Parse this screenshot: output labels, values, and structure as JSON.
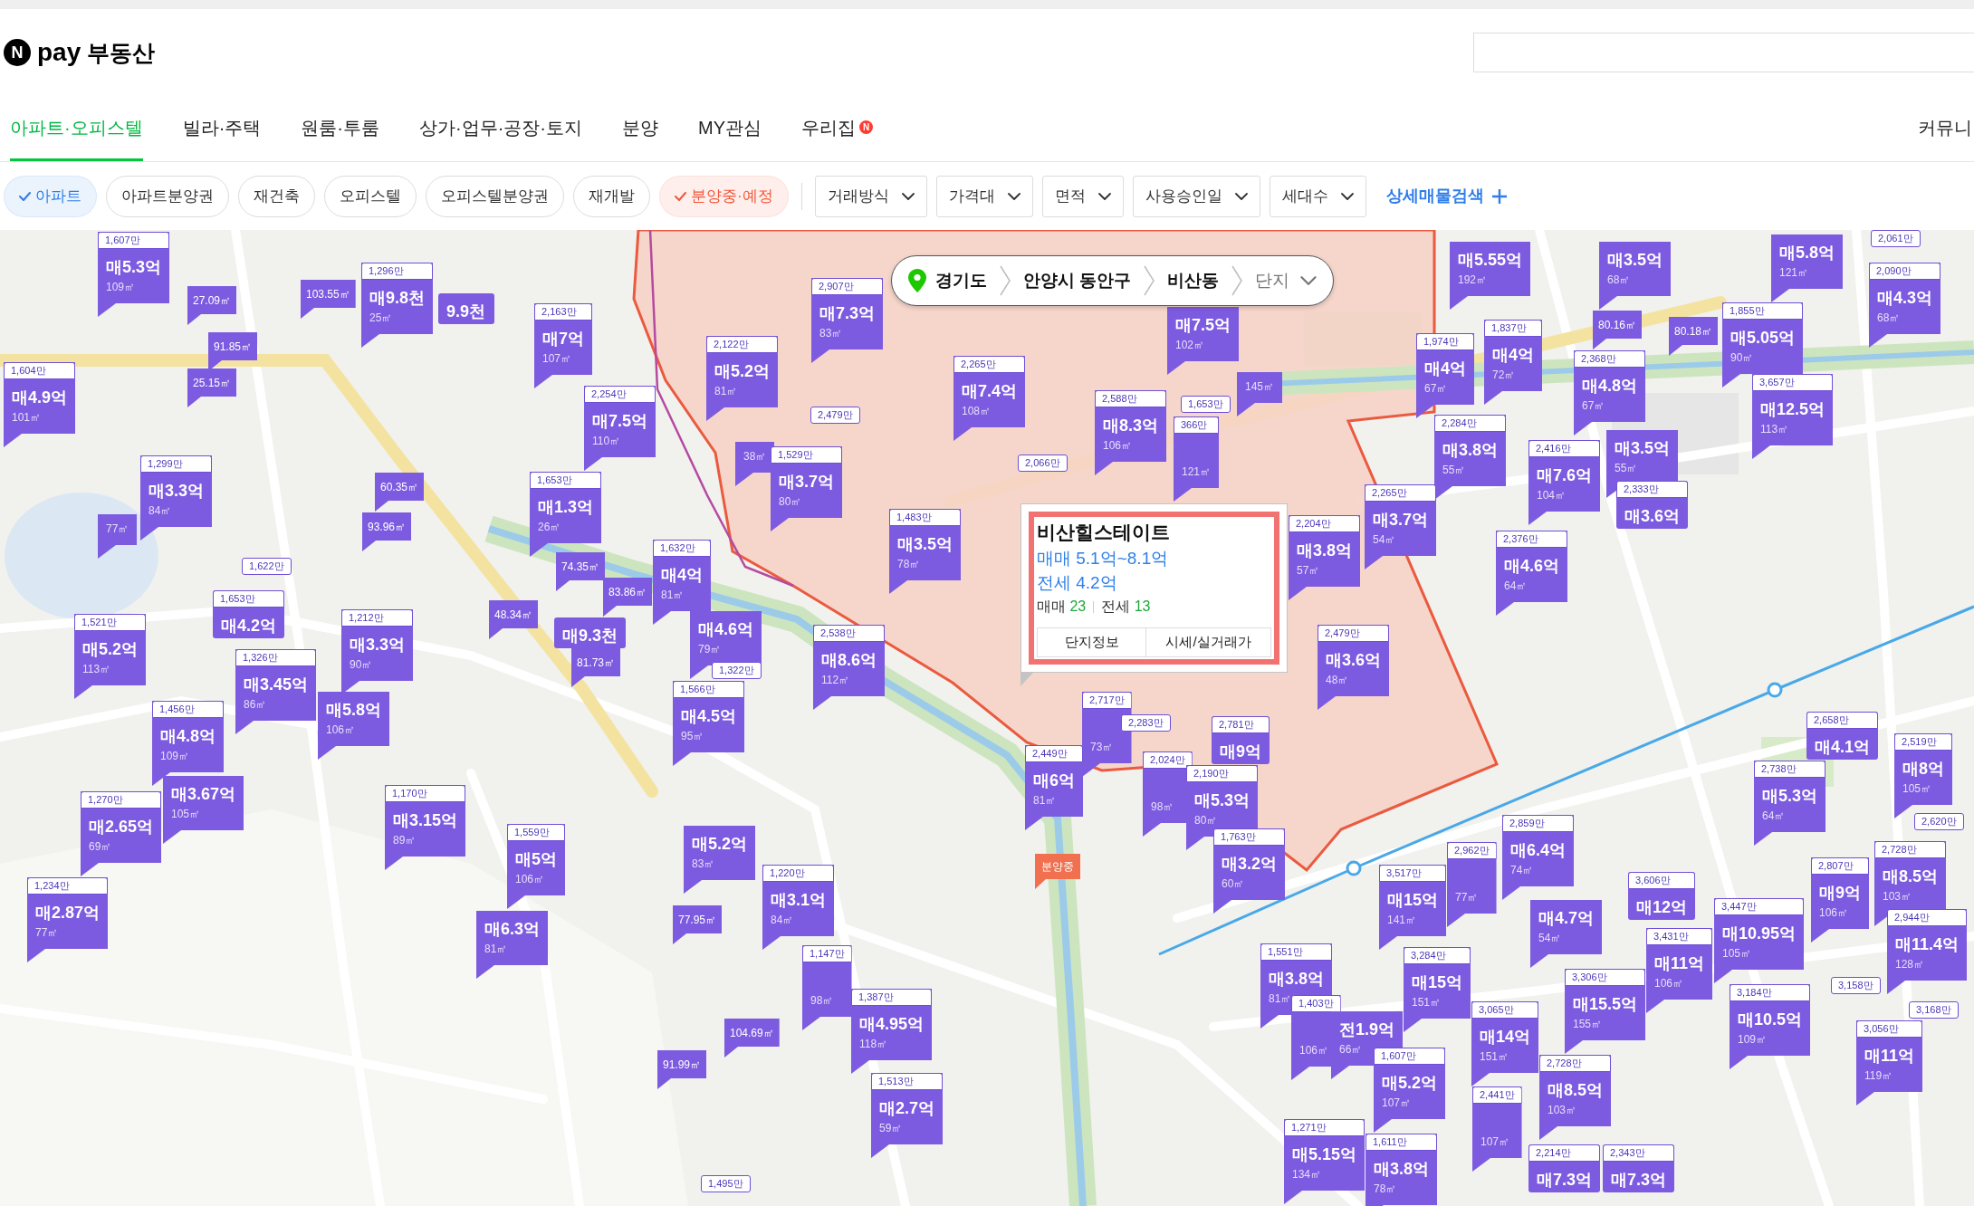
{
  "header": {
    "logo": {
      "badge": "N",
      "brand": "pay",
      "title": "부동산"
    }
  },
  "nav_tabs": [
    {
      "label": "아파트·오피스텔",
      "selected": true
    },
    {
      "label": "빌라·주택",
      "selected": false
    },
    {
      "label": "원룸·투룸",
      "selected": false
    },
    {
      "label": "상가·업무·공장·토지",
      "selected": false
    },
    {
      "label": "분양",
      "selected": false
    },
    {
      "label": "MY관심",
      "selected": false
    },
    {
      "label": "우리집",
      "selected": false,
      "badge": "N"
    },
    {
      "label": "커뮤니",
      "selected": false
    }
  ],
  "type_chips": [
    {
      "label": "아파트",
      "selected": true,
      "color": "#2e7de9"
    },
    {
      "label": "아파트분양권",
      "selected": false
    },
    {
      "label": "재건축",
      "selected": false
    },
    {
      "label": "오피스텔",
      "selected": false
    },
    {
      "label": "오피스텔분양권",
      "selected": false
    },
    {
      "label": "재개발",
      "selected": false
    },
    {
      "label": "분양중·예정",
      "selected": true,
      "color": "#f1573a"
    }
  ],
  "filters": [
    {
      "label": "거래방식"
    },
    {
      "label": "가격대"
    },
    {
      "label": "면적"
    },
    {
      "label": "사용승인일"
    },
    {
      "label": "세대수"
    }
  ],
  "detail_search": {
    "label": "상세매물검색"
  },
  "map": {
    "breadcrumb": {
      "levels": [
        "경기도",
        "안양시 동안구",
        "비산동"
      ],
      "dropdown": "단지"
    },
    "markers": [
      {
        "kind": "listing",
        "unit_price": "1,607만",
        "price": "매5.3억",
        "area": "109㎡"
      },
      {
        "kind": "listing",
        "price": "매5.55억",
        "area": "192㎡"
      },
      {
        "kind": "listing",
        "price": "매3.5억",
        "area": "68㎡"
      },
      {
        "kind": "listing",
        "price": "매5.8억",
        "area": "121㎡"
      },
      {
        "kind": "listing",
        "unit_price": "2,061만"
      },
      {
        "kind": "area",
        "area": "27.09㎡"
      },
      {
        "kind": "area",
        "area": "103.55㎡"
      },
      {
        "kind": "listing",
        "unit_price": "1,296만",
        "price": "매9.8천",
        "area": "25㎡"
      },
      {
        "kind": "listing",
        "price": "9.9천"
      },
      {
        "kind": "listing",
        "unit_price": "2,907만",
        "price": "매7.3억",
        "area": "83㎡"
      },
      {
        "kind": "listing",
        "unit_price": "2,090만",
        "price": "매4.3억",
        "area": "68㎡"
      },
      {
        "kind": "area",
        "area": "91.85㎡"
      },
      {
        "kind": "listing",
        "unit_price": "2,163만",
        "price": "매7억",
        "area": "107㎡"
      },
      {
        "kind": "listing",
        "price": "매7.5억",
        "area": "102㎡"
      },
      {
        "kind": "area",
        "area": "80.16㎡"
      },
      {
        "kind": "area",
        "area": "80.18㎡"
      },
      {
        "kind": "listing",
        "unit_price": "1,855만",
        "price": "매5.05억",
        "area": "90㎡"
      },
      {
        "kind": "area",
        "area": "25.15㎡"
      },
      {
        "kind": "listing",
        "unit_price": "2,122만",
        "price": "매5.2억",
        "area": "81㎡"
      },
      {
        "kind": "listing",
        "unit_price": "1,974만",
        "price": "매4억",
        "area": "67㎡"
      },
      {
        "kind": "listing",
        "unit_price": "1,837만",
        "price": "매4억",
        "area": "72㎡"
      },
      {
        "kind": "listing",
        "unit_price": "1,604만",
        "price": "매4.9억",
        "area": "101㎡"
      },
      {
        "kind": "listing",
        "unit_price": "2,254만",
        "price": "매7.5억",
        "area": "110㎡"
      },
      {
        "kind": "listing",
        "unit_price": "2,479만"
      },
      {
        "kind": "listing",
        "unit_price": "2,265만",
        "price": "매7.4억",
        "area": "108㎡"
      },
      {
        "kind": "listing",
        "unit_price": "2,588만",
        "price": "매8.3억",
        "area": "106㎡"
      },
      {
        "kind": "listing",
        "unit_price": "1,653만"
      },
      {
        "kind": "listing",
        "unit_price": "366만",
        "area": "121㎡"
      },
      {
        "kind": "listing",
        "area": "145㎡"
      },
      {
        "kind": "listing",
        "unit_price": "2,284만",
        "price": "매3.8억",
        "area": "55㎡"
      },
      {
        "kind": "listing",
        "unit_price": "2,368만",
        "price": "매4.8억",
        "area": "67㎡"
      },
      {
        "kind": "listing",
        "unit_price": "3,657만",
        "price": "매12.5억",
        "area": "113㎡"
      },
      {
        "kind": "listing",
        "area": "38㎡"
      },
      {
        "kind": "listing",
        "unit_price": "1,529만",
        "price": "매3.7억",
        "area": "80㎡"
      },
      {
        "kind": "listing",
        "unit_price": "2,066만"
      },
      {
        "kind": "listing",
        "unit_price": "2,416만",
        "price": "매7.6억",
        "area": "104㎡"
      },
      {
        "kind": "listing",
        "price": "매3.5억",
        "area": "55㎡"
      },
      {
        "kind": "listing",
        "area": "77㎡"
      },
      {
        "kind": "listing",
        "unit_price": "1,299만",
        "price": "매3.3억",
        "area": "84㎡"
      },
      {
        "kind": "area",
        "area": "60.35㎡"
      },
      {
        "kind": "area",
        "area": "93.96㎡"
      },
      {
        "kind": "listing",
        "unit_price": "1,653만",
        "price": "매1.3억",
        "area": "26㎡"
      },
      {
        "kind": "listing",
        "unit_price": "2,333만",
        "price": "매3.6억"
      },
      {
        "kind": "listing",
        "unit_price": "1,483만",
        "price": "매3.5억",
        "area": "78㎡"
      },
      {
        "kind": "listing",
        "unit_price": "2,265만",
        "price": "매3.7억",
        "area": "54㎡"
      },
      {
        "kind": "listing",
        "unit_price": "1,622만"
      },
      {
        "kind": "area",
        "area": "74.35㎡"
      },
      {
        "kind": "listing",
        "unit_price": "1,632만",
        "price": "매4억",
        "area": "81㎡"
      },
      {
        "kind": "listing",
        "unit_price": "2,204만",
        "price": "매3.8억",
        "area": "57㎡"
      },
      {
        "kind": "listing",
        "unit_price": "2,376만",
        "price": "매4.6억",
        "area": "64㎡"
      },
      {
        "kind": "listing",
        "unit_price": "1,653만",
        "price": "매4.2억"
      },
      {
        "kind": "area",
        "area": "48.34㎡"
      },
      {
        "kind": "area",
        "area": "83.86㎡"
      },
      {
        "kind": "listing",
        "unit_price": "1,521만",
        "price": "매5.2억",
        "area": "113㎡"
      },
      {
        "kind": "listing",
        "unit_price": "1,212만",
        "price": "매3.3억",
        "area": "90㎡"
      },
      {
        "kind": "listing",
        "price": "매9.3천"
      },
      {
        "kind": "listing",
        "price": "매4.6억",
        "area": "79㎡"
      },
      {
        "kind": "listing",
        "unit_price": "1,326만",
        "price": "매3.45억",
        "area": "86㎡"
      },
      {
        "kind": "area",
        "area": "81.73㎡"
      },
      {
        "kind": "listing",
        "unit_price": "1,322만"
      },
      {
        "kind": "listing",
        "unit_price": "2,538만",
        "price": "매8.6억",
        "area": "112㎡"
      },
      {
        "kind": "listing",
        "unit_price": "2,479만",
        "price": "매3.6억",
        "area": "48㎡"
      },
      {
        "kind": "listing",
        "unit_price": "1,456만",
        "price": "매4.8억",
        "area": "109㎡"
      },
      {
        "kind": "listing",
        "price": "매5.8억",
        "area": "106㎡"
      },
      {
        "kind": "listing",
        "unit_price": "1,566만",
        "price": "매4.5억",
        "area": "95㎡"
      },
      {
        "kind": "listing",
        "unit_price": "2,717만",
        "area": "73㎡"
      },
      {
        "kind": "listing",
        "unit_price": "2,283만"
      },
      {
        "kind": "listing",
        "unit_price": "2,781만",
        "price": "매9억"
      },
      {
        "kind": "listing",
        "unit_price": "2,658만",
        "price": "매4.1억"
      },
      {
        "kind": "listing",
        "price": "매3.67억",
        "area": "105㎡"
      },
      {
        "kind": "listing",
        "unit_price": "2,449만",
        "price": "매6억",
        "area": "81㎡"
      },
      {
        "kind": "listing",
        "unit_price": "2,024만",
        "area": "98㎡"
      },
      {
        "kind": "listing",
        "unit_price": "2,190만",
        "price": "매5.3억",
        "area": "80㎡"
      },
      {
        "kind": "listing",
        "unit_price": "2,738만",
        "price": "매5.3억",
        "area": "64㎡"
      },
      {
        "kind": "listing",
        "unit_price": "2,519만",
        "price": "매8억",
        "area": "105㎡"
      },
      {
        "kind": "listing",
        "unit_price": "1,270만",
        "price": "매2.65억",
        "area": "69㎡"
      },
      {
        "kind": "listing",
        "unit_price": "1,170만",
        "price": "매3.15억",
        "area": "89㎡"
      },
      {
        "kind": "listing",
        "unit_price": "1,559만",
        "price": "매5억",
        "area": "106㎡"
      },
      {
        "kind": "listing",
        "price": "매5.2억",
        "area": "83㎡"
      },
      {
        "kind": "listing",
        "unit_price": "1,763만",
        "price": "매3.2억",
        "area": "60㎡"
      },
      {
        "kind": "listing",
        "unit_price": "2,962만",
        "area": "77㎡"
      },
      {
        "kind": "listing",
        "unit_price": "2,859만",
        "price": "매6.4억",
        "area": "74㎡"
      },
      {
        "kind": "listing",
        "unit_price": "2,620만"
      },
      {
        "kind": "listing",
        "unit_price": "2,728만",
        "price": "매8.5억",
        "area": "103㎡"
      },
      {
        "kind": "listing",
        "unit_price": "1,234만",
        "price": "매2.87억",
        "area": "77㎡"
      },
      {
        "kind": "listing",
        "unit_price": "1,220만",
        "price": "매3.1억",
        "area": "84㎡"
      },
      {
        "kind": "listing",
        "unit_price": "3,517만",
        "price": "매15억",
        "area": "141㎡"
      },
      {
        "kind": "listing",
        "unit_price": "3,606만",
        "price": "매12억"
      },
      {
        "kind": "listing",
        "unit_price": "2,807만",
        "price": "매9억",
        "area": "106㎡"
      },
      {
        "kind": "listing",
        "price": "매6.3억",
        "area": "81㎡"
      },
      {
        "kind": "area",
        "area": "77.95㎡"
      },
      {
        "kind": "listing",
        "price": "매4.7억",
        "area": "54㎡"
      },
      {
        "kind": "listing",
        "unit_price": "3,447만",
        "price": "매10.95억",
        "area": "105㎡"
      },
      {
        "kind": "listing",
        "unit_price": "2,944만",
        "price": "매11.4억",
        "area": "128㎡"
      },
      {
        "kind": "listing",
        "unit_price": "1,147만",
        "area": "98㎡"
      },
      {
        "kind": "listing",
        "unit_price": "1,551만",
        "price": "매3.8억",
        "area": "81㎡"
      },
      {
        "kind": "listing",
        "unit_price": "3,284만",
        "price": "매15억",
        "area": "151㎡"
      },
      {
        "kind": "listing",
        "unit_price": "3,431만",
        "price": "매11억",
        "area": "106㎡"
      },
      {
        "kind": "listing",
        "unit_price": "3,158만"
      },
      {
        "kind": "area",
        "area": "104.69㎡"
      },
      {
        "kind": "listing",
        "unit_price": "1,387만",
        "price": "매4.95억",
        "area": "118㎡"
      },
      {
        "kind": "listing",
        "unit_price": "1,403만",
        "area": "106㎡"
      },
      {
        "kind": "listing",
        "price": "전1.9억",
        "area": "66㎡"
      },
      {
        "kind": "listing",
        "unit_price": "3,065만",
        "price": "매14억",
        "area": "151㎡"
      },
      {
        "kind": "listing",
        "unit_price": "3,306만",
        "price": "매15.5억",
        "area": "155㎡"
      },
      {
        "kind": "listing",
        "unit_price": "3,184만",
        "price": "매10.5억",
        "area": "109㎡"
      },
      {
        "kind": "listing",
        "unit_price": "3,168만"
      },
      {
        "kind": "area",
        "area": "91.99㎡"
      },
      {
        "kind": "listing",
        "unit_price": "3,056만",
        "price": "매11억",
        "area": "119㎡"
      },
      {
        "kind": "listing",
        "unit_price": "1,513만",
        "price": "매2.7억",
        "area": "59㎡"
      },
      {
        "kind": "listing",
        "unit_price": "1,607만",
        "price": "매5.2억",
        "area": "107㎡"
      },
      {
        "kind": "listing",
        "unit_price": "2,728만",
        "price": "매8.5억",
        "area": "103㎡"
      },
      {
        "kind": "listing",
        "unit_price": "2,441만",
        "area": "107㎡"
      },
      {
        "kind": "listing",
        "unit_price": "1,495만"
      },
      {
        "kind": "listing",
        "unit_price": "1,271만",
        "price": "매5.15억",
        "area": "134㎡"
      },
      {
        "kind": "listing",
        "unit_price": "1,611만",
        "price": "매3.8억",
        "area": "78㎡"
      },
      {
        "kind": "listing",
        "unit_price": "2,214만",
        "price": "매7.3억"
      },
      {
        "kind": "listing",
        "unit_price": "2,343만",
        "price": "매7.3억"
      }
    ],
    "presale_marker": {
      "label": "분양중"
    },
    "popup": {
      "name": "비산힐스테이트",
      "sale_range": "매매 5.1억~8.1억",
      "jeonse_range": "전세 4.2억",
      "counts": [
        {
          "label": "매매",
          "value": "23"
        },
        {
          "label": "전세",
          "value": "13"
        }
      ],
      "buttons": [
        "단지정보",
        "시세/실거래가"
      ]
    }
  }
}
